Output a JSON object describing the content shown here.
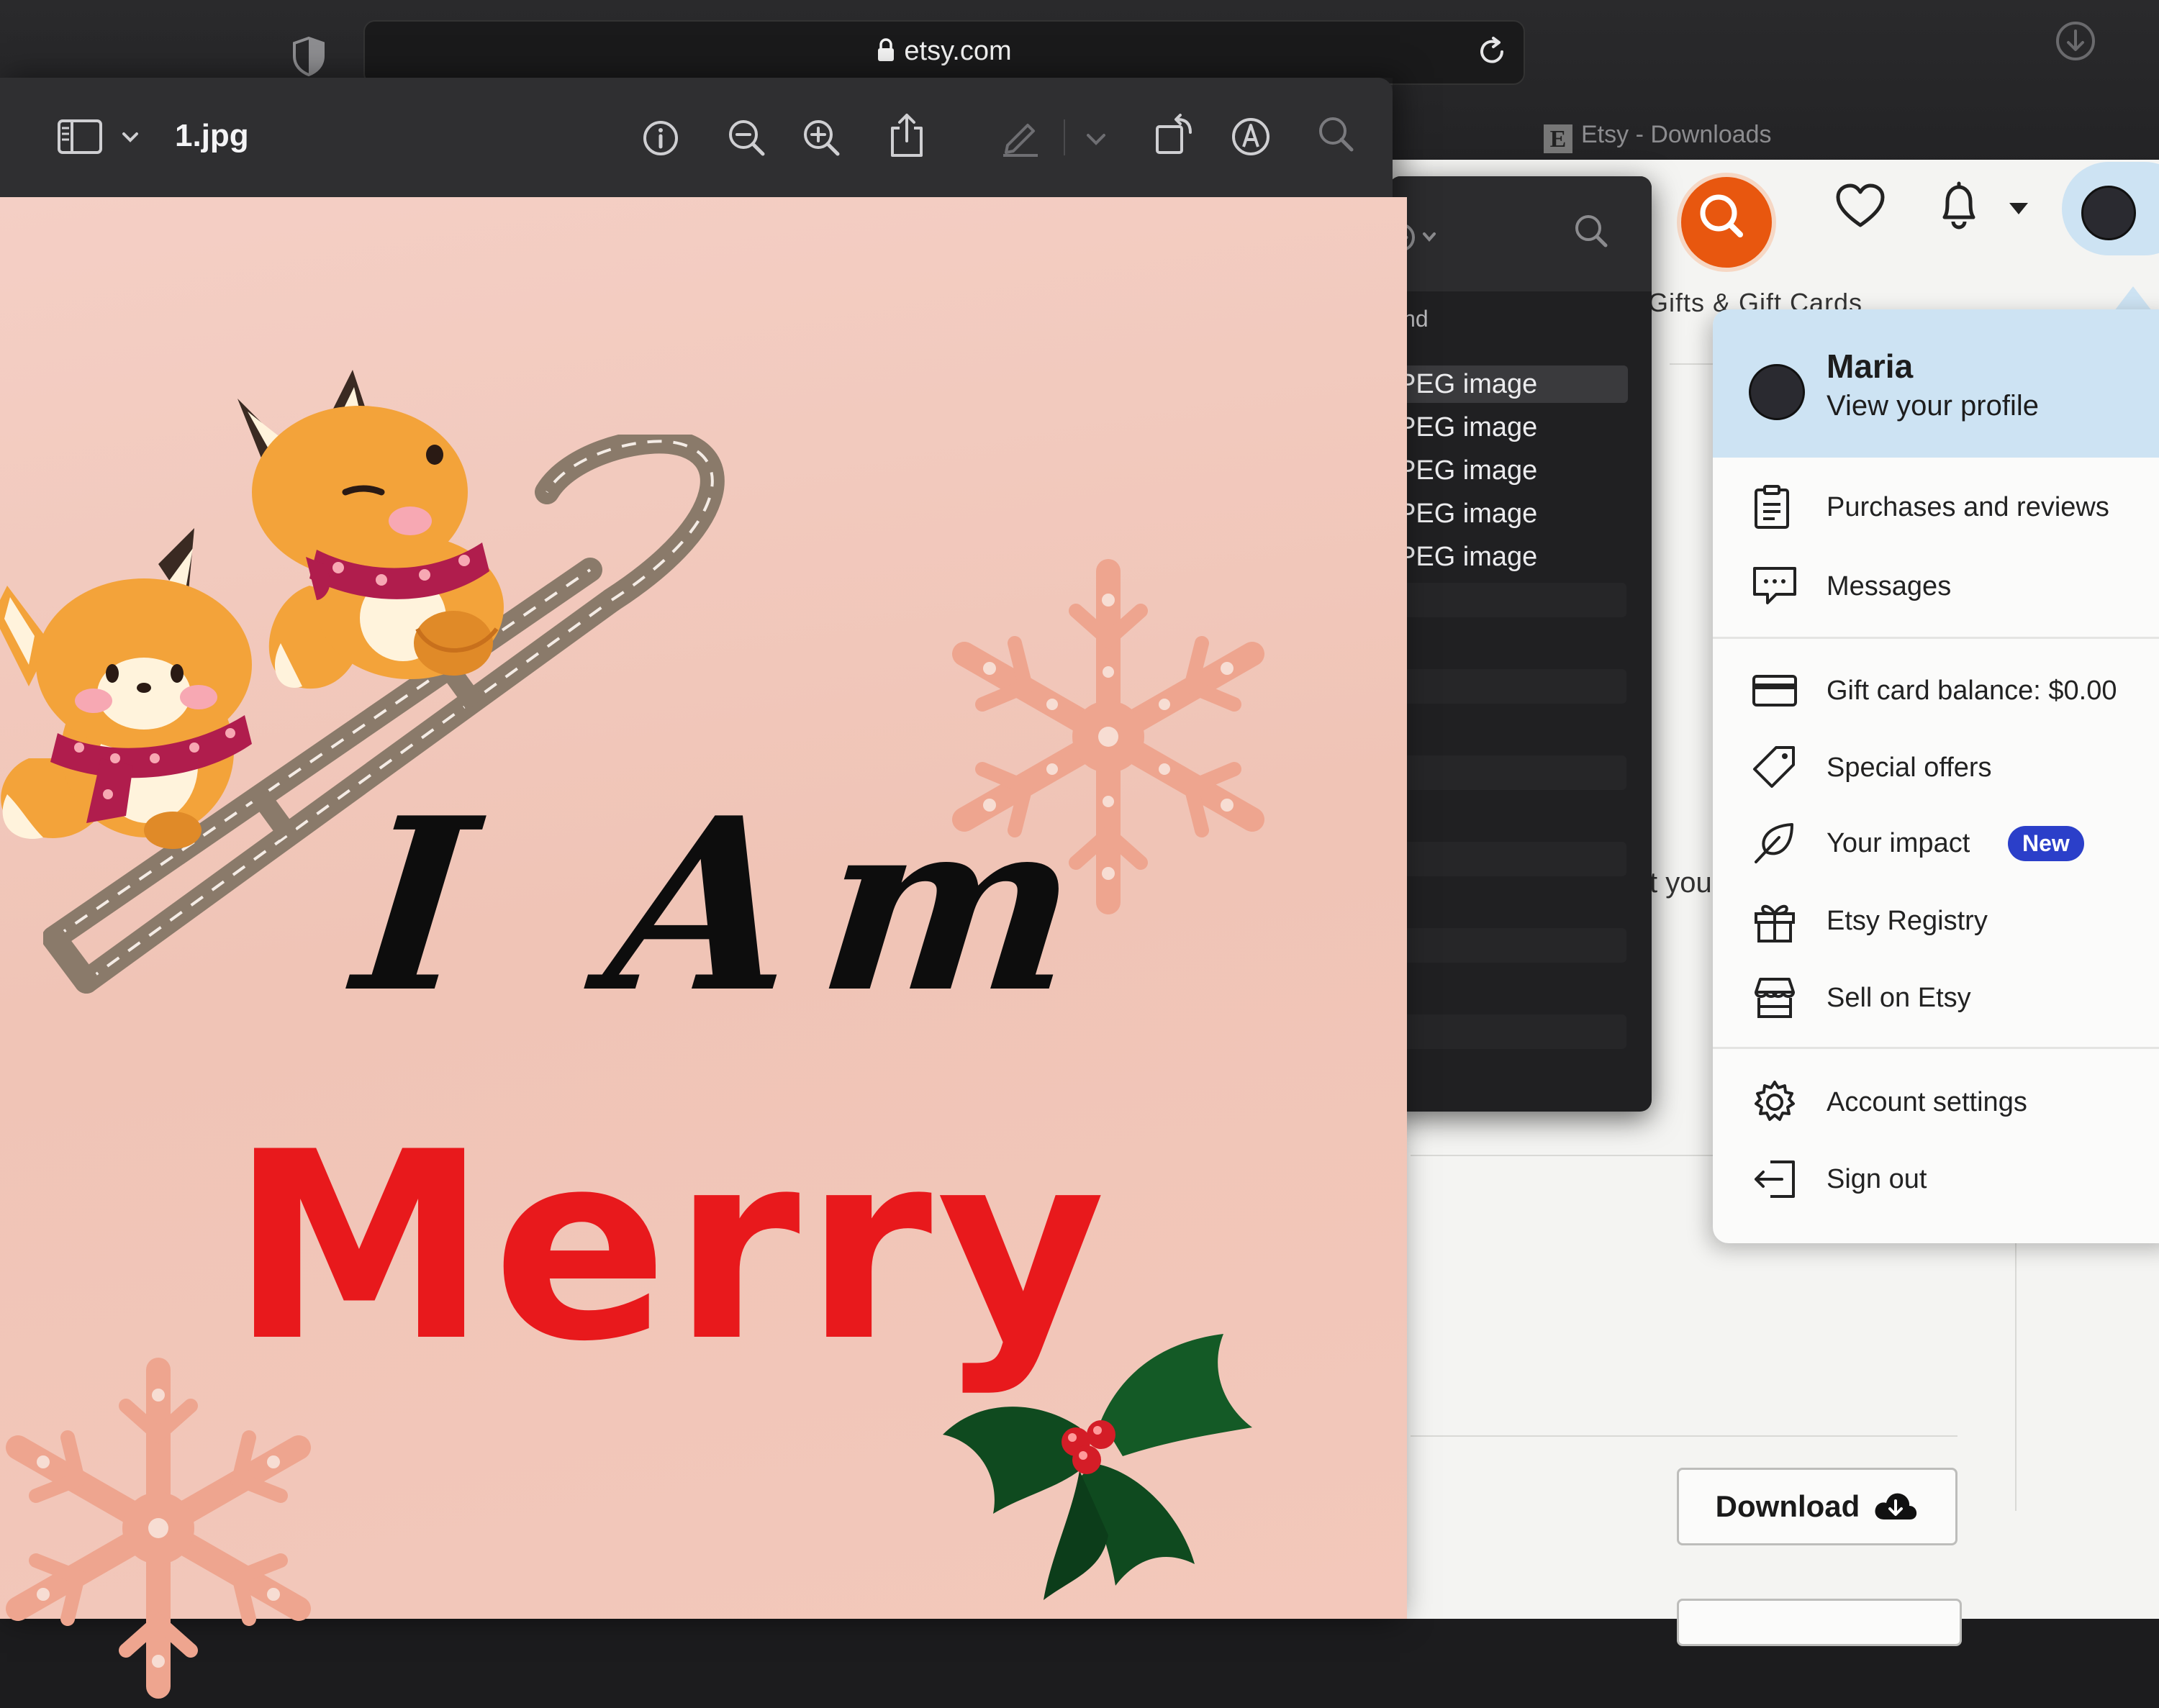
{
  "browser": {
    "url": "etsy.com",
    "tab_title": "Etsy - Downloads",
    "tab_initial": "E"
  },
  "preview": {
    "file_name": "1.jpg",
    "image_text": {
      "line1": "I Am",
      "line2": "Merry"
    },
    "colors": {
      "background": "#f2c8bb",
      "script_text": "#0d0d0d",
      "merry_text": "#e8191c",
      "snowflake": "#eea58f"
    }
  },
  "finder": {
    "column_header": "ind",
    "rows": [
      "PEG image",
      "PEG image",
      "PEG image",
      "PEG image",
      "PEG image"
    ]
  },
  "etsy": {
    "nav_partial": "Gifts & Gift Cards",
    "body_partial": "t you",
    "download_label": "Download",
    "accent": "#e8570f"
  },
  "menu": {
    "name": "Maria",
    "profile_link": "View your profile",
    "items": [
      {
        "label": "Purchases and reviews",
        "icon": "clipboard-icon"
      },
      {
        "label": "Messages",
        "icon": "message-icon"
      },
      {
        "label": "Gift card balance: $0.00",
        "icon": "credit-card-icon"
      },
      {
        "label": "Special offers",
        "icon": "tag-icon"
      },
      {
        "label": "Your impact",
        "icon": "leaf-icon",
        "badge": "New"
      },
      {
        "label": "Etsy Registry",
        "icon": "gift-icon"
      },
      {
        "label": "Sell on Etsy",
        "icon": "shop-icon"
      },
      {
        "label": "Account settings",
        "icon": "gear-icon"
      },
      {
        "label": "Sign out",
        "icon": "sign-out-icon"
      }
    ],
    "header_color": "#cde3f3",
    "badge_color": "#2b3fc9"
  }
}
